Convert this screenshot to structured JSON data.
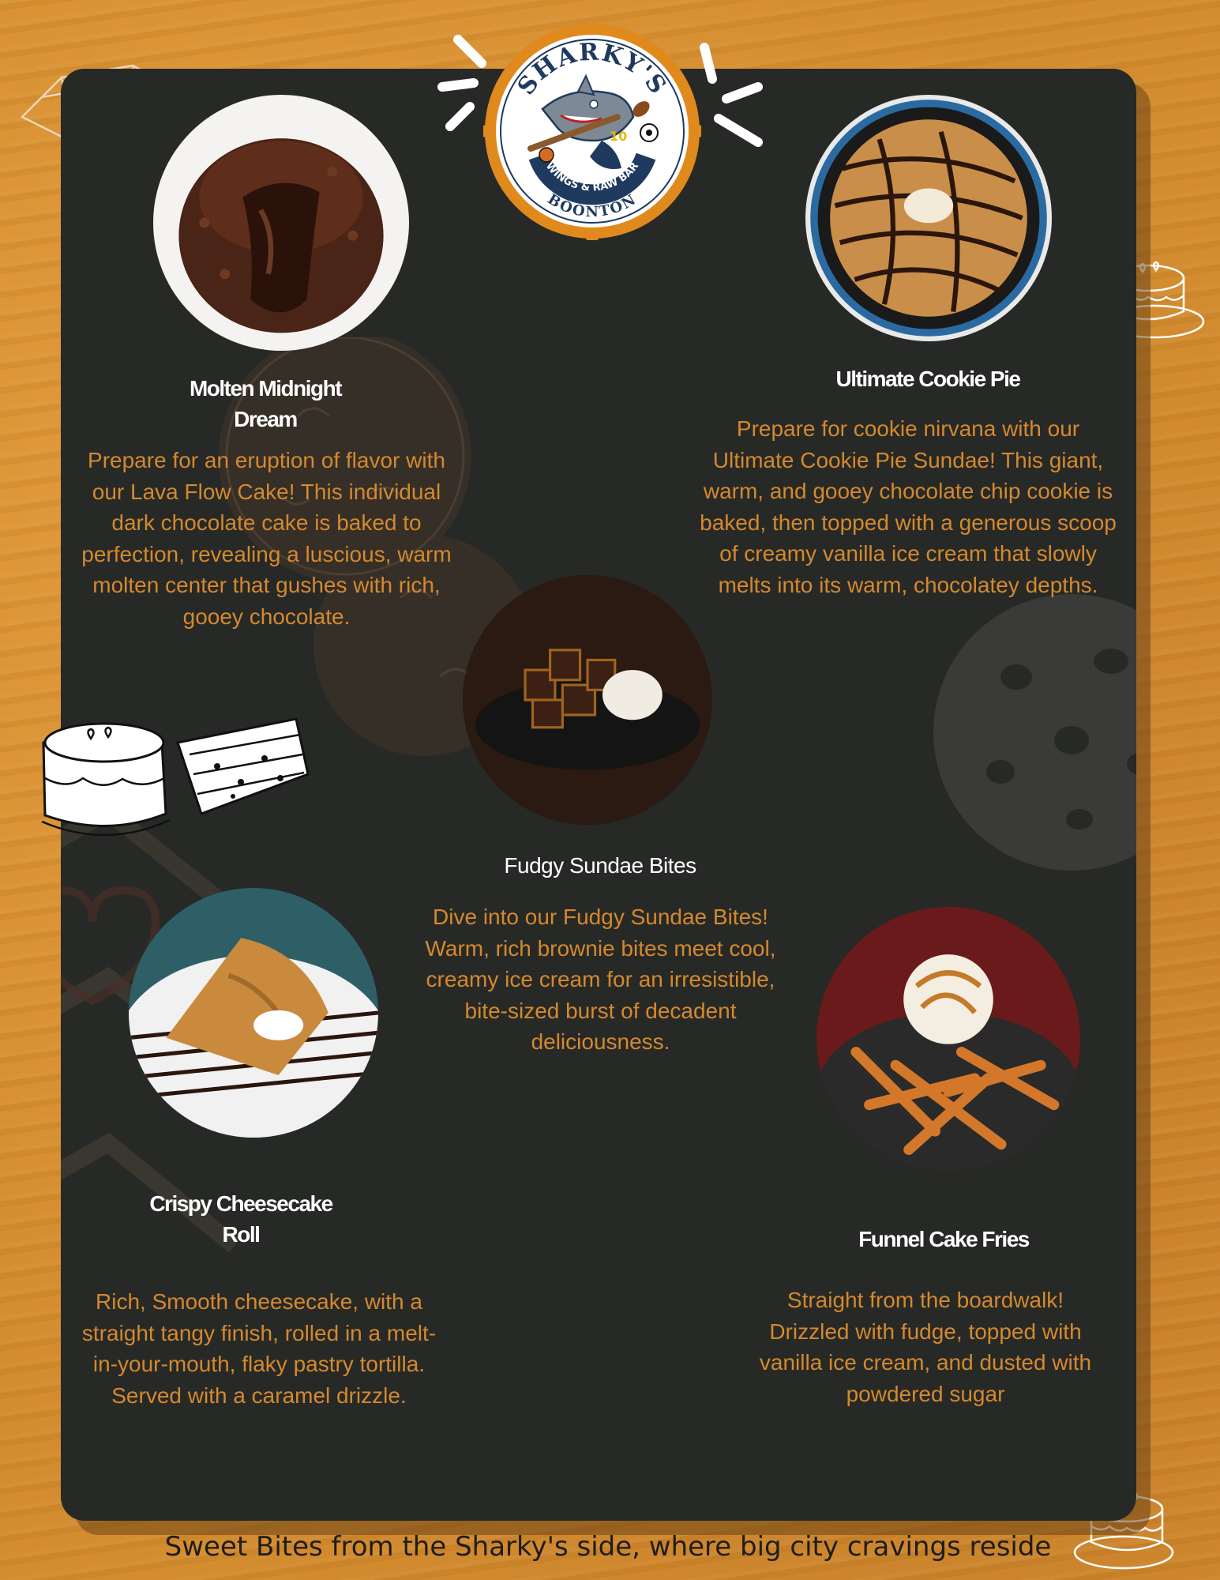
{
  "logo": {
    "brand": "SHARKY'S",
    "jersey_number": "10",
    "tagline": "WINGS & RAW BAR",
    "location": "BOONTON"
  },
  "items": [
    {
      "name": "Molten Midnight Dream",
      "description": "Prepare for an eruption of flavor with our Lava Flow Cake! This individual dark chocolate cake is baked to perfection, revealing a luscious, warm molten center that gushes with rich, gooey chocolate."
    },
    {
      "name": "Ultimate Cookie Pie",
      "description": "Prepare for cookie nirvana with our Ultimate Cookie Pie Sundae! This giant, warm, and gooey chocolate chip cookie is baked, then topped with a generous scoop of creamy vanilla ice cream that slowly melts into its warm, chocolatey depths."
    },
    {
      "name": "Fudgy Sundae Bites",
      "description": "Dive into our Fudgy Sundae Bites! Warm, rich brownie bites meet cool, creamy ice cream for an irresistible, bite-sized burst of decadent deliciousness."
    },
    {
      "name": "Crispy Cheesecake Roll",
      "description": "Rich, Smooth   cheesecake, with a straight tangy finish, rolled in a melt-in-your-mouth, flaky pastry tortilla. Served with a caramel drizzle."
    },
    {
      "name": "Funnel Cake Fries",
      "description": "Straight from the boardwalk! Drizzled with fudge, topped with vanilla ice cream, and dusted with powdered sugar"
    }
  ],
  "footer": "Sweet Bites from the Sharky's side, where big city cravings reside",
  "colors": {
    "background": "#d38a2c",
    "board": "#272927",
    "accent_text": "#d4892e",
    "title_text": "#ffffff",
    "logo_ring": "#e08a1e",
    "logo_navy": "#1f3a5f"
  }
}
